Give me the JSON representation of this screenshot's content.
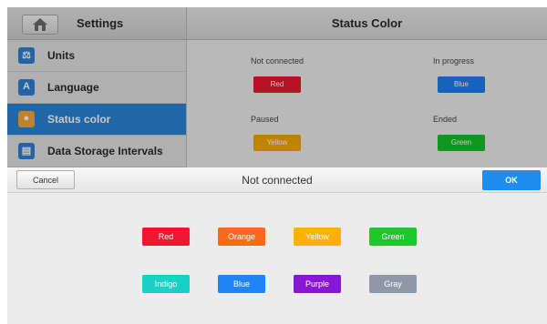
{
  "header": {
    "left_title": "Settings",
    "right_title": "Status Color"
  },
  "sidebar": {
    "items": [
      {
        "label": "Units",
        "icon": "scale-icon",
        "glyph": "⚖",
        "active": false
      },
      {
        "label": "Language",
        "icon": "language-icon",
        "glyph": "A",
        "active": false
      },
      {
        "label": "Status color",
        "icon": "palette-icon",
        "glyph": "●",
        "active": true
      },
      {
        "label": "Data Storage Intervals",
        "icon": "storage-icon",
        "glyph": "▤",
        "active": false
      }
    ]
  },
  "status_slots": [
    {
      "label": "Not connected",
      "color_name": "Red",
      "color": "#e8182e"
    },
    {
      "label": "In progress",
      "color_name": "Blue",
      "color": "#1e7ff0"
    },
    {
      "label": "Paused",
      "color_name": "Yellow",
      "color": "#f5a800"
    },
    {
      "label": "Ended",
      "color_name": "Green",
      "color": "#17c12c"
    }
  ],
  "picker": {
    "cancel_label": "Cancel",
    "title": "Not connected",
    "ok_label": "OK",
    "colors": [
      {
        "name": "Red",
        "hex": "#f01530"
      },
      {
        "name": "Orange",
        "hex": "#fb6a1a"
      },
      {
        "name": "Yellow",
        "hex": "#ffb000"
      },
      {
        "name": "Green",
        "hex": "#1dc82c"
      },
      {
        "name": "Indigo",
        "hex": "#19d0c4"
      },
      {
        "name": "Blue",
        "hex": "#1f84f5"
      },
      {
        "name": "Purple",
        "hex": "#8a15d8"
      },
      {
        "name": "Gray",
        "hex": "#8e98a8"
      }
    ]
  }
}
